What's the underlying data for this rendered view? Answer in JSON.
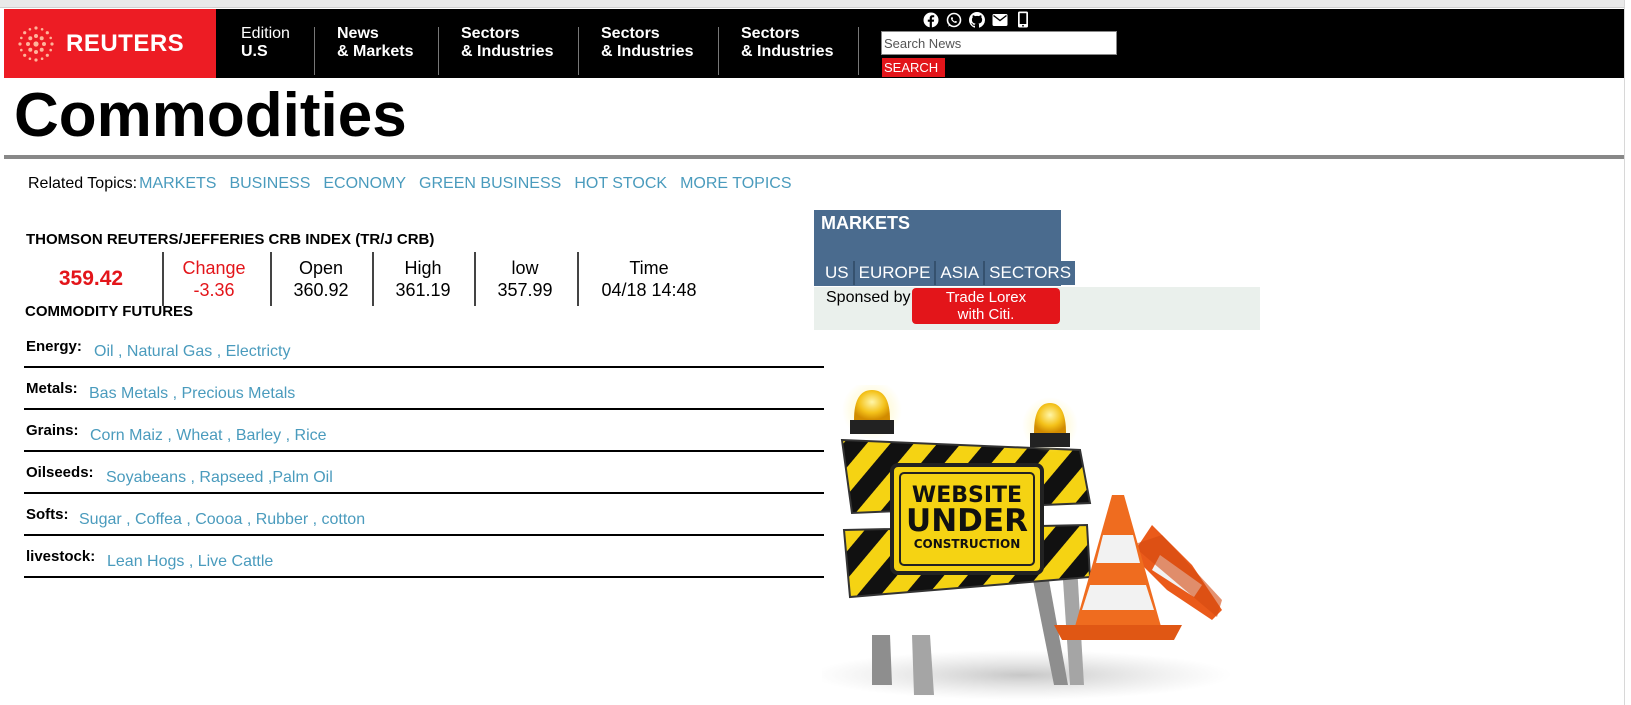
{
  "header": {
    "logo_text": "REUTERS",
    "nav": [
      {
        "line1": "Edition",
        "line2": "U.S"
      },
      {
        "line1": "News",
        "line2": "& Markets"
      },
      {
        "line1": "Sectors",
        "line2": "& Industries"
      },
      {
        "line1": "Sectors",
        "line2": "& Industries"
      },
      {
        "line1": "Sectors",
        "line2": "& Industries"
      }
    ],
    "social_icons": [
      "facebook-icon",
      "whatsapp-icon",
      "github-icon",
      "mail-icon",
      "mobile-icon"
    ],
    "search": {
      "placeholder": "Search News",
      "button_label": "SEARCH"
    }
  },
  "page": {
    "title": "Commodities",
    "related_label": "Related Topics:",
    "related_topics": [
      "MARKETS",
      "BUSINESS",
      "ECONOMY",
      "GREEN BUSINESS",
      "HOT STOCK",
      "MORE TOPICS"
    ]
  },
  "index": {
    "title": "THOMSON REUTERS/JEFFERIES CRB INDEX (TR/J CRB)",
    "value": "359.42",
    "change_label": "Change",
    "change_value": "-3.36",
    "open_label": "Open",
    "open_value": "360.92",
    "high_label": "High",
    "high_value": "361.19",
    "low_label": "low",
    "low_value": "357.99",
    "time_label": "Time",
    "time_value": "04/18 14:48"
  },
  "futures": {
    "title": "COMMODITY FUTURES",
    "rows": [
      {
        "label": "Energy:",
        "links": "Oil , Natural Gas , Electricty"
      },
      {
        "label": "Metals:",
        "links": "Bas Metals , Precious Metals"
      },
      {
        "label": "Grains:",
        "links": "Corn Maiz , Wheat , Barley , Rice"
      },
      {
        "label": "Oilseeds:",
        "links": "Soyabeans , Rapseed ,Palm Oil"
      },
      {
        "label": "Softs:",
        "links": "Sugar , Coffea , Coooa , Rubber , cotton"
      },
      {
        "label": "livestock:",
        "links": "Lean Hogs , Live Cattle"
      }
    ]
  },
  "markets": {
    "title": "MARKETS",
    "tabs": [
      "US",
      "EUROPE",
      "ASIA",
      "SECTORS"
    ],
    "sponsored_label": "Sponsed by",
    "sponsor_button": {
      "line1": "Trade Lorex",
      "line2": "with Citi."
    }
  },
  "construction": {
    "line1": "WEBSITE",
    "line2": "UNDER",
    "line3": "CONSTRUCTION"
  },
  "colors": {
    "brand_red": "#ed1c24",
    "link_blue": "#4a9bbd",
    "markets_blue": "#4a6b8e"
  }
}
